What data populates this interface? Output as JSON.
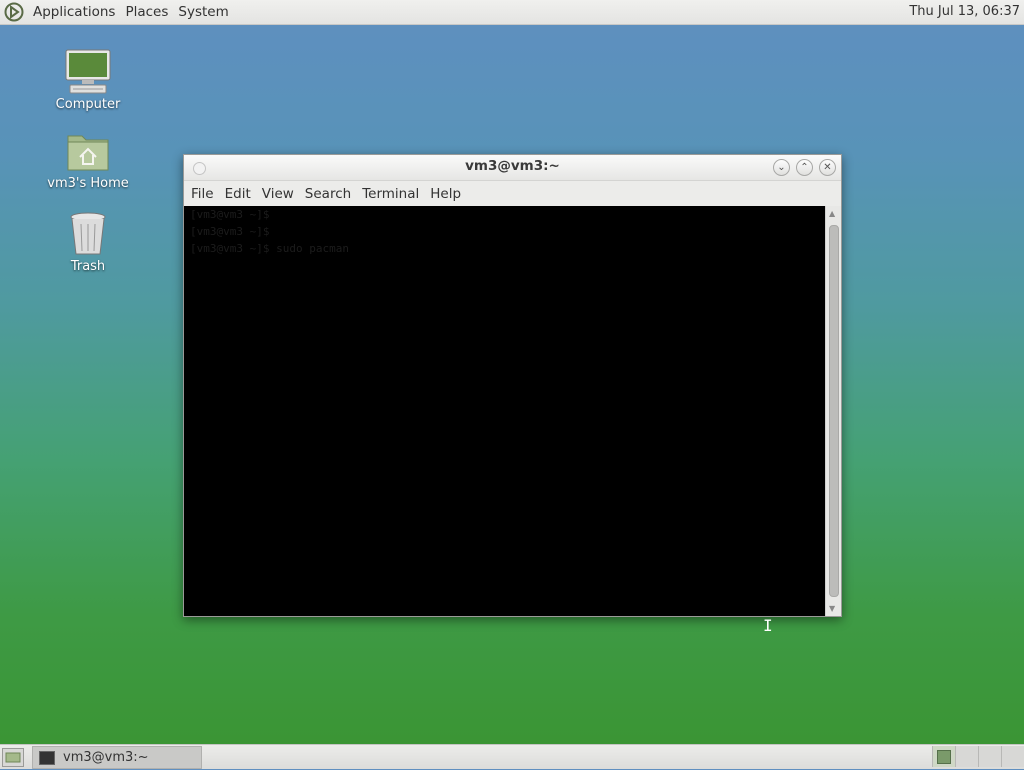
{
  "top_panel": {
    "menus": [
      "Applications",
      "Places",
      "System"
    ],
    "clock": "Thu Jul 13, 06:37"
  },
  "desktop": {
    "icons": [
      {
        "label": "Computer",
        "icon": "computer-icon"
      },
      {
        "label": "vm3's Home",
        "icon": "home-folder-icon"
      },
      {
        "label": "Trash",
        "icon": "trash-icon"
      }
    ]
  },
  "window": {
    "title": "vm3@vm3:~",
    "menus": [
      "File",
      "Edit",
      "View",
      "Search",
      "Terminal",
      "Help"
    ],
    "terminal_lines": [
      "[vm3@vm3 ~]$",
      "[vm3@vm3 ~]$",
      "[vm3@vm3 ~]$ sudo pacman"
    ]
  },
  "taskbar": {
    "task_label": "vm3@vm3:~"
  },
  "colors": {
    "terminal_bg": "#000000",
    "desktop_top": "#5f8fc0",
    "desktop_bottom": "#3a9431"
  }
}
